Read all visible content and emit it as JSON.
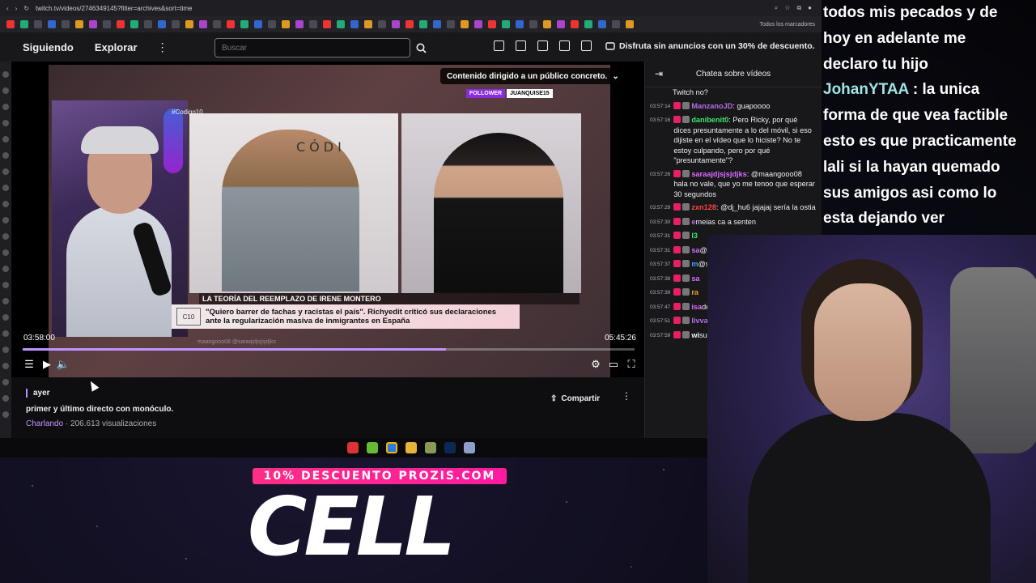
{
  "browser": {
    "url": "twitch.tv/videos/2746349145?filter=archives&sort=time",
    "bookmarks_all": "Todos los marcadores"
  },
  "nav": {
    "following": "Siguiendo",
    "explore": "Explorar",
    "search_placeholder": "Buscar",
    "promo": "Disfruta sin anuncios con un 30% de descuento."
  },
  "video": {
    "content_warning": "Contenido dirigido a un público concreto.",
    "hashtag": "#Codigo10",
    "brand": "CÓDI",
    "follow_label": "FOLLOWER",
    "follow_user": "JUANQUISE15",
    "lower_title": "LA TEORÍA DEL REEMPLAZO DE IRENE MONTERO",
    "lower_logo": "C10",
    "lower_quote_line1": "\"Quiero barrer de fachas y racistas el país\". Richyedit criticó sus declaraciones",
    "lower_quote_line2": "ante la regularización masiva de inmigrantes en España",
    "ghost_chat_1": "maangooo08 @saraajdjsjsjdjks",
    "current_time": "03:58:00",
    "duration": "05:45:26",
    "progress": 0.692,
    "buffered": 0.71
  },
  "info": {
    "date": "ayer",
    "title": "primer y último directo con monóculo.",
    "category": "Charlando",
    "views": " · 206.613 visualizaciones",
    "share": "Compartir"
  },
  "chat": {
    "header": "Chatea sobre vídeos",
    "messages": [
      {
        "ts": "",
        "user": "",
        "text": "Twitch no?",
        "color": "#efeff1"
      },
      {
        "ts": "03:57:14",
        "user": "ManzanoJD",
        "text": ": guapoooo",
        "color": "#b36be6"
      },
      {
        "ts": "03:57:16",
        "user": "danibenit0",
        "text": ": Pero Ricky, por qué dices presuntamente a lo del móvil, si eso dijiste en el vídeo que lo hiciste? No te estoy culpando, pero por qué \"presuntamente\"?",
        "color": "#3ee66e"
      },
      {
        "ts": "03:57:26",
        "user": "saraajdjsjsjdjks",
        "text": ": @maangooo08 hala no vale, que yo me tenoo que esperar 30 segundos",
        "color": "#d66bff"
      },
      {
        "ts": "03:57:29",
        "user": "zxn128",
        "text": ": @dj_hu6 jajajaj sería la ostia",
        "color": "#ff4545"
      },
      {
        "ts": "03:57:30",
        "user": "e",
        "text": "meias ca a senten",
        "color": "#b36be6"
      },
      {
        "ts": "03:57:31",
        "user": "l3",
        "text": "",
        "color": "#3ee66e"
      },
      {
        "ts": "03:57:31",
        "user": "sa",
        "text": "@maang",
        "color": "#d66bff"
      },
      {
        "ts": "03:57:37",
        "user": "m",
        "text": "@saraaj",
        "color": "#4b9cff"
      },
      {
        "ts": "03:57:38",
        "user": "sa",
        "text": "",
        "color": "#d66bff"
      },
      {
        "ts": "03:57:39",
        "user": "ra",
        "text": "",
        "color": "#ff9a3c"
      },
      {
        "ts": "03:57:47",
        "user": "isa",
        "text": "debate ?",
        "color": "#d66bff"
      },
      {
        "ts": "03:57:51",
        "user": "livva",
        "text": "",
        "color": "#b36be6"
      },
      {
        "ts": "03:57:59",
        "user": "wi",
        "text": "subscrib",
        "color": "#efeff1"
      }
    ]
  },
  "overlay": {
    "line1": "todos mis pecados y de",
    "line2": "hoy en adelante me",
    "line3": "declaro tu hijo",
    "user": "JohanYTAA",
    "line4": " : la unica",
    "line5": "forma de que vea factible",
    "line6": "esto es que practicamente",
    "line7": "lali si la hayan quemado",
    "line8": "sus amigos asi como lo",
    "line9": "esta dejando ver"
  },
  "sponsor": {
    "tag": "10% DESCUENTO PROZIS.COM",
    "code": "CELL"
  }
}
